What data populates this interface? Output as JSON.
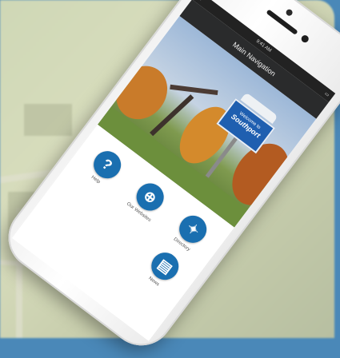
{
  "status_bar": {
    "time": "9:41 AM",
    "left_icon": "wifi-icon",
    "right_icon": "battery-icon"
  },
  "nav_bar": {
    "title": "Main Navigation"
  },
  "hero": {
    "sign_line1": "Welcome to",
    "sign_line2": "Southport"
  },
  "tiles": [
    {
      "icon": "help-icon",
      "glyph": "?",
      "label": "Help"
    },
    {
      "icon": "globe-icon",
      "glyph": "⊕",
      "label": "Our Websites"
    },
    {
      "icon": "compass-icon",
      "glyph": "✦",
      "label": "Directory"
    },
    {
      "icon": "",
      "glyph": "",
      "label": ""
    },
    {
      "icon": "",
      "glyph": "",
      "label": ""
    },
    {
      "icon": "news-icon",
      "glyph": "▤",
      "label": "News"
    }
  ],
  "colors": {
    "accent": "#1a6fb0",
    "navbar": "#2a2b2c",
    "frame": "#4a88b8"
  }
}
